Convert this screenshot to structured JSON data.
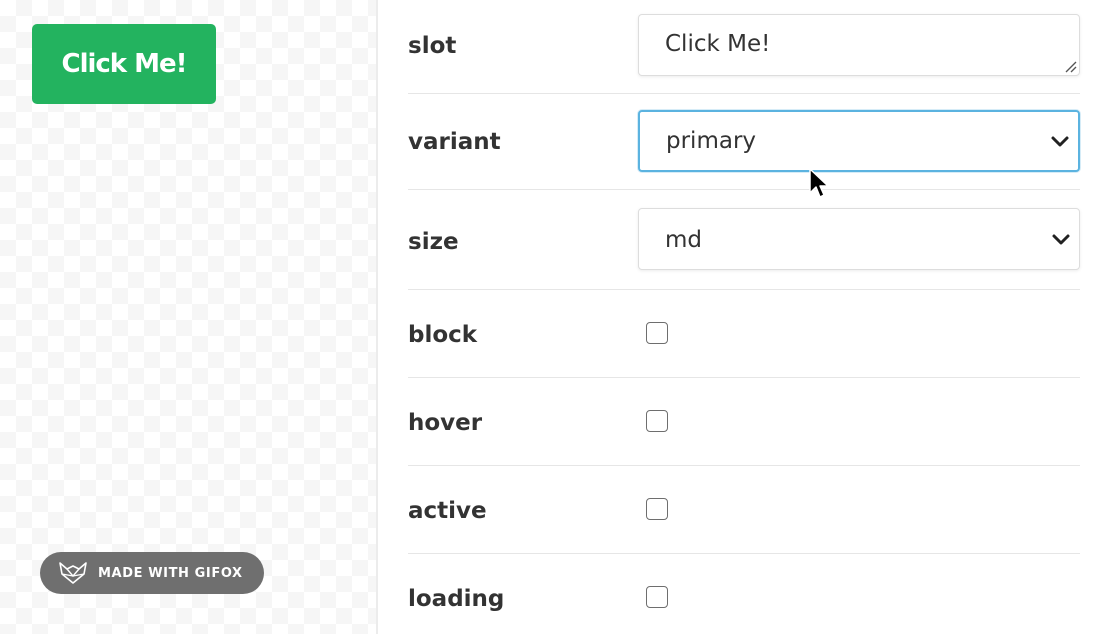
{
  "preview": {
    "button_label": "Click Me!",
    "button_color": "#23b35f",
    "badge_text": "MADE WITH GIFOX"
  },
  "props": {
    "slot": {
      "label": "slot",
      "value": "Click Me!"
    },
    "variant": {
      "label": "variant",
      "value": "primary",
      "icon": "chevron-down-icon"
    },
    "size": {
      "label": "size",
      "value": "md",
      "icon": "chevron-down-icon"
    },
    "block": {
      "label": "block",
      "checked": false
    },
    "hover": {
      "label": "hover",
      "checked": false
    },
    "active": {
      "label": "active",
      "checked": false
    },
    "loading": {
      "label": "loading",
      "checked": false
    }
  },
  "colors": {
    "focus_border": "#5bb3e0",
    "label_text": "#333333"
  }
}
